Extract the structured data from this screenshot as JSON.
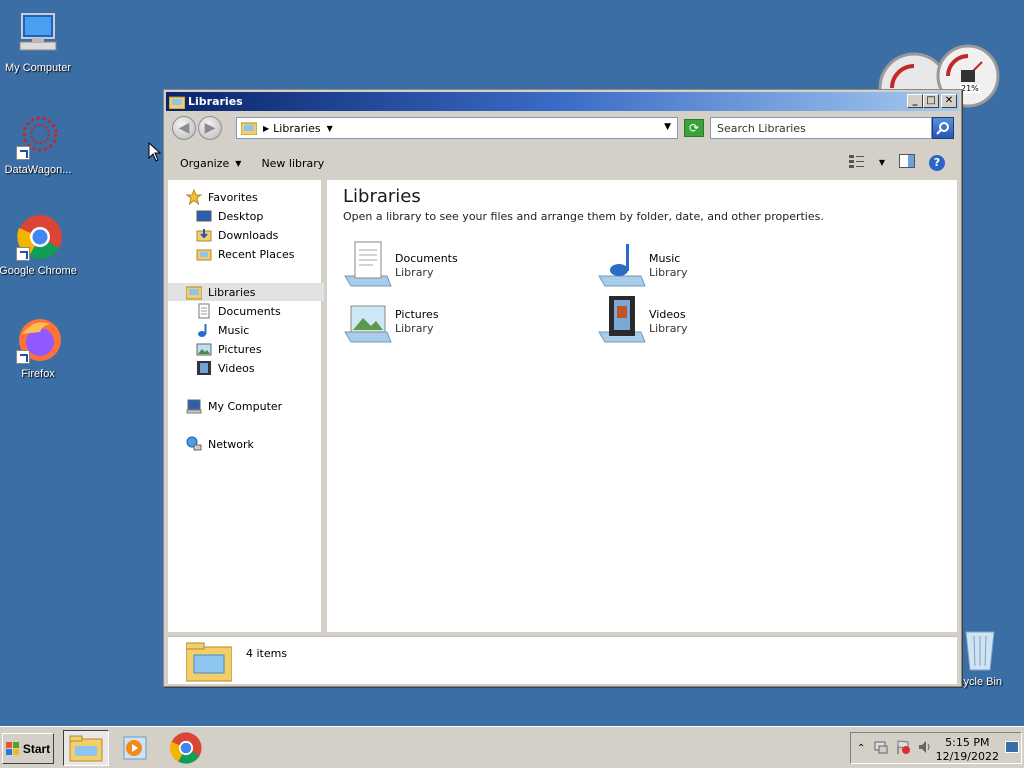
{
  "desktop": {
    "icons": [
      {
        "label": "My Computer"
      },
      {
        "label": "DataWagon..."
      },
      {
        "label": "Google Chrome"
      },
      {
        "label": "Firefox"
      },
      {
        "label": "cycle Bin"
      }
    ],
    "gadget_percent": "21%"
  },
  "window": {
    "title": "Libraries",
    "address": {
      "crumb": "Libraries"
    },
    "search": {
      "placeholder": "Search Libraries"
    },
    "commands": {
      "organize": "Organize",
      "new_library": "New library"
    },
    "nav": {
      "favorites": "Favorites",
      "desktop": "Desktop",
      "downloads": "Downloads",
      "recent_places": "Recent Places",
      "libraries": "Libraries",
      "documents": "Documents",
      "music": "Music",
      "pictures": "Pictures",
      "videos": "Videos",
      "my_computer": "My Computer",
      "network": "Network"
    },
    "content": {
      "title": "Libraries",
      "subtitle": "Open a library to see your files and arrange them by folder, date, and other properties.",
      "libraries": [
        {
          "name": "Documents",
          "type": "Library"
        },
        {
          "name": "Music",
          "type": "Library"
        },
        {
          "name": "Pictures",
          "type": "Library"
        },
        {
          "name": "Videos",
          "type": "Library"
        }
      ]
    },
    "details": {
      "count": "4 items"
    }
  },
  "taskbar": {
    "start_label": "Start",
    "clock_time": "5:15 PM",
    "clock_date": "12/19/2022"
  }
}
